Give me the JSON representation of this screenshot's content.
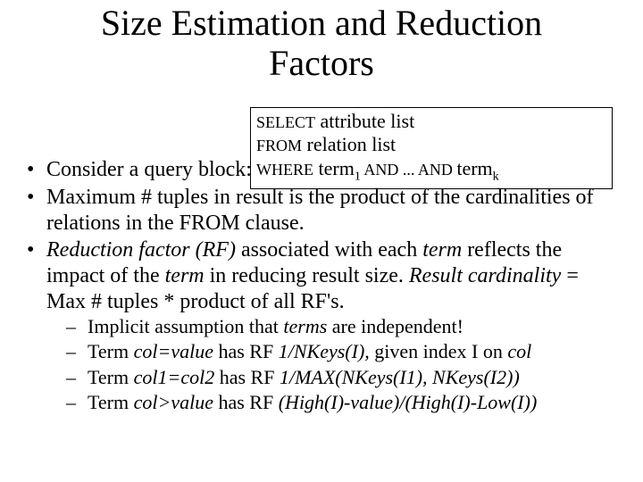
{
  "title_line1": "Size Estimation and Reduction",
  "title_line2": "Factors",
  "query": {
    "select_kw": "SELECT",
    "select_rest": " attribute list",
    "from_kw": "FROM",
    "from_rest": " relation list",
    "where_kw": "WHERE",
    "where_t": " term",
    "where_and1": " AND",
    "where_dots": " ...",
    "where_and2": " AND ",
    "where_tk": "term",
    "sub1": "1",
    "subk": "k"
  },
  "bullets": {
    "b1": "Consider a query block:",
    "b2": "Maximum # tuples in result is the product of the cardinalities of relations in the FROM clause.",
    "b3_a": "Reduction factor (RF)",
    "b3_b": " associated with each ",
    "b3_c": "term",
    "b3_d": " reflects the impact of the ",
    "b3_e": "term",
    "b3_f": " in reducing result size. ",
    "b3_g": "Result cardinality",
    "b3_h": " = Max # tuples  *  product of all RF's."
  },
  "subs": {
    "s1_a": "Implicit assumption that ",
    "s1_b": "terms",
    "s1_c": " are independent!",
    "s2_a": "Term ",
    "s2_b": "col=value",
    "s2_c": " has RF ",
    "s2_d": "1/NKeys(I),",
    "s2_e": " given index I on ",
    "s2_f": "col",
    "s3_a": "Term ",
    "s3_b": "col1=col2",
    "s3_c": " has RF ",
    "s3_d": "1/MAX(NKeys(I1), NKeys(I2))",
    "s4_a": "Term ",
    "s4_b": "col>value",
    "s4_c": " has RF ",
    "s4_d": "(High(I)-value)/(High(I)-Low(I))"
  }
}
